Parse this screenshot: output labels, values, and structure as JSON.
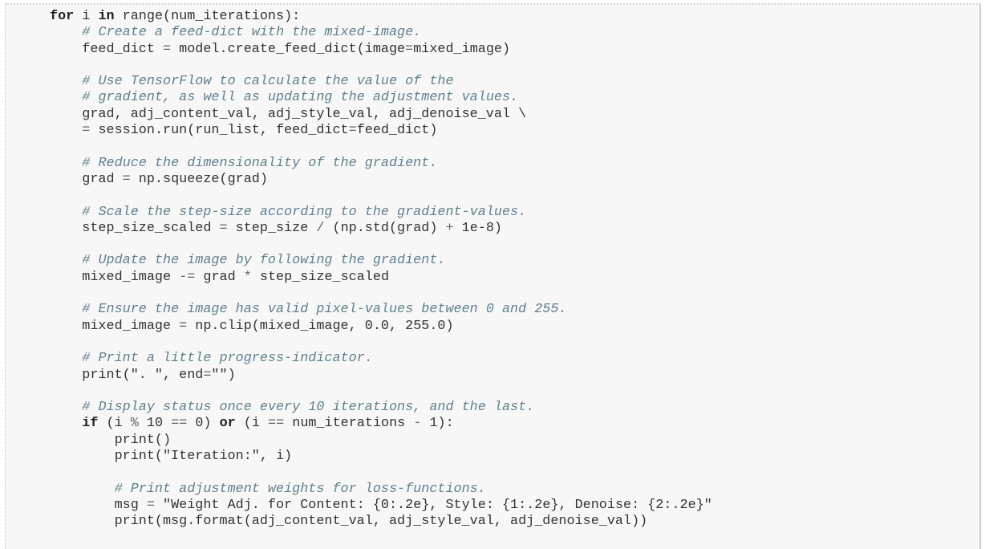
{
  "cell": {
    "lines": [
      [
        [
          "for",
          "kw"
        ],
        [
          " i ",
          ""
        ],
        [
          "in",
          "kw"
        ],
        [
          " range(num_iterations):",
          ""
        ]
      ],
      [
        [
          "    ",
          ""
        ],
        [
          "# Create a feed-dict with the mixed-image.",
          "cm"
        ]
      ],
      [
        [
          "    feed_dict ",
          ""
        ],
        [
          "=",
          "op"
        ],
        [
          " model.create_feed_dict(image",
          ""
        ],
        [
          "=",
          "op"
        ],
        [
          "mixed_image)",
          ""
        ]
      ],
      [],
      [
        [
          "    ",
          ""
        ],
        [
          "# Use TensorFlow to calculate the value of the",
          "cm"
        ]
      ],
      [
        [
          "    ",
          ""
        ],
        [
          "# gradient, as well as updating the adjustment values.",
          "cm"
        ]
      ],
      [
        [
          "    grad, adj_content_val, adj_style_val, adj_denoise_val \\",
          ""
        ]
      ],
      [
        [
          "    ",
          ""
        ],
        [
          "=",
          "op"
        ],
        [
          " session.run(run_list, feed_dict",
          ""
        ],
        [
          "=",
          "op"
        ],
        [
          "feed_dict)",
          ""
        ]
      ],
      [],
      [
        [
          "    ",
          ""
        ],
        [
          "# Reduce the dimensionality of the gradient.",
          "cm"
        ]
      ],
      [
        [
          "    grad ",
          ""
        ],
        [
          "=",
          "op"
        ],
        [
          " np.squeeze(grad)",
          ""
        ]
      ],
      [],
      [
        [
          "    ",
          ""
        ],
        [
          "# Scale the step-size according to the gradient-values.",
          "cm"
        ]
      ],
      [
        [
          "    step_size_scaled ",
          ""
        ],
        [
          "=",
          "op"
        ],
        [
          " step_size ",
          ""
        ],
        [
          "/",
          "op"
        ],
        [
          " (np.std(grad) ",
          ""
        ],
        [
          "+",
          "op"
        ],
        [
          " 1e-8)",
          ""
        ]
      ],
      [],
      [
        [
          "    ",
          ""
        ],
        [
          "# Update the image by following the gradient.",
          "cm"
        ]
      ],
      [
        [
          "    mixed_image ",
          ""
        ],
        [
          "-=",
          "op"
        ],
        [
          " grad ",
          ""
        ],
        [
          "*",
          "op"
        ],
        [
          " step_size_scaled",
          ""
        ]
      ],
      [],
      [
        [
          "    ",
          ""
        ],
        [
          "# Ensure the image has valid pixel-values between 0 and 255.",
          "cm"
        ]
      ],
      [
        [
          "    mixed_image ",
          ""
        ],
        [
          "=",
          "op"
        ],
        [
          " np.clip(mixed_image, 0.0, 255.0)",
          ""
        ]
      ],
      [],
      [
        [
          "    ",
          ""
        ],
        [
          "# Print a little progress-indicator.",
          "cm"
        ]
      ],
      [
        [
          "    print(\". \", end",
          ""
        ],
        [
          "=",
          "op"
        ],
        [
          "\"\")",
          ""
        ]
      ],
      [],
      [
        [
          "    ",
          ""
        ],
        [
          "# Display status once every 10 iterations, and the last.",
          "cm"
        ]
      ],
      [
        [
          "    ",
          ""
        ],
        [
          "if",
          "kw"
        ],
        [
          " (i ",
          ""
        ],
        [
          "%",
          "op"
        ],
        [
          " 10 ",
          ""
        ],
        [
          "==",
          "op"
        ],
        [
          " 0) ",
          ""
        ],
        [
          "or",
          "kw"
        ],
        [
          " (i ",
          ""
        ],
        [
          "==",
          "op"
        ],
        [
          " num_iterations ",
          ""
        ],
        [
          "-",
          "op"
        ],
        [
          " 1):",
          ""
        ]
      ],
      [
        [
          "        print()",
          ""
        ]
      ],
      [
        [
          "        print(\"Iteration:\", i)",
          ""
        ]
      ],
      [],
      [
        [
          "        ",
          ""
        ],
        [
          "# Print adjustment weights for loss-functions.",
          "cm"
        ]
      ],
      [
        [
          "        msg ",
          ""
        ],
        [
          "=",
          "op"
        ],
        [
          " \"Weight Adj. for Content: {0:.2e}, Style: {1:.2e}, Denoise: {2:.2e}\"",
          ""
        ]
      ],
      [
        [
          "        print(msg.format(adj_content_val, adj_style_val, adj_denoise_val))",
          ""
        ]
      ]
    ]
  }
}
